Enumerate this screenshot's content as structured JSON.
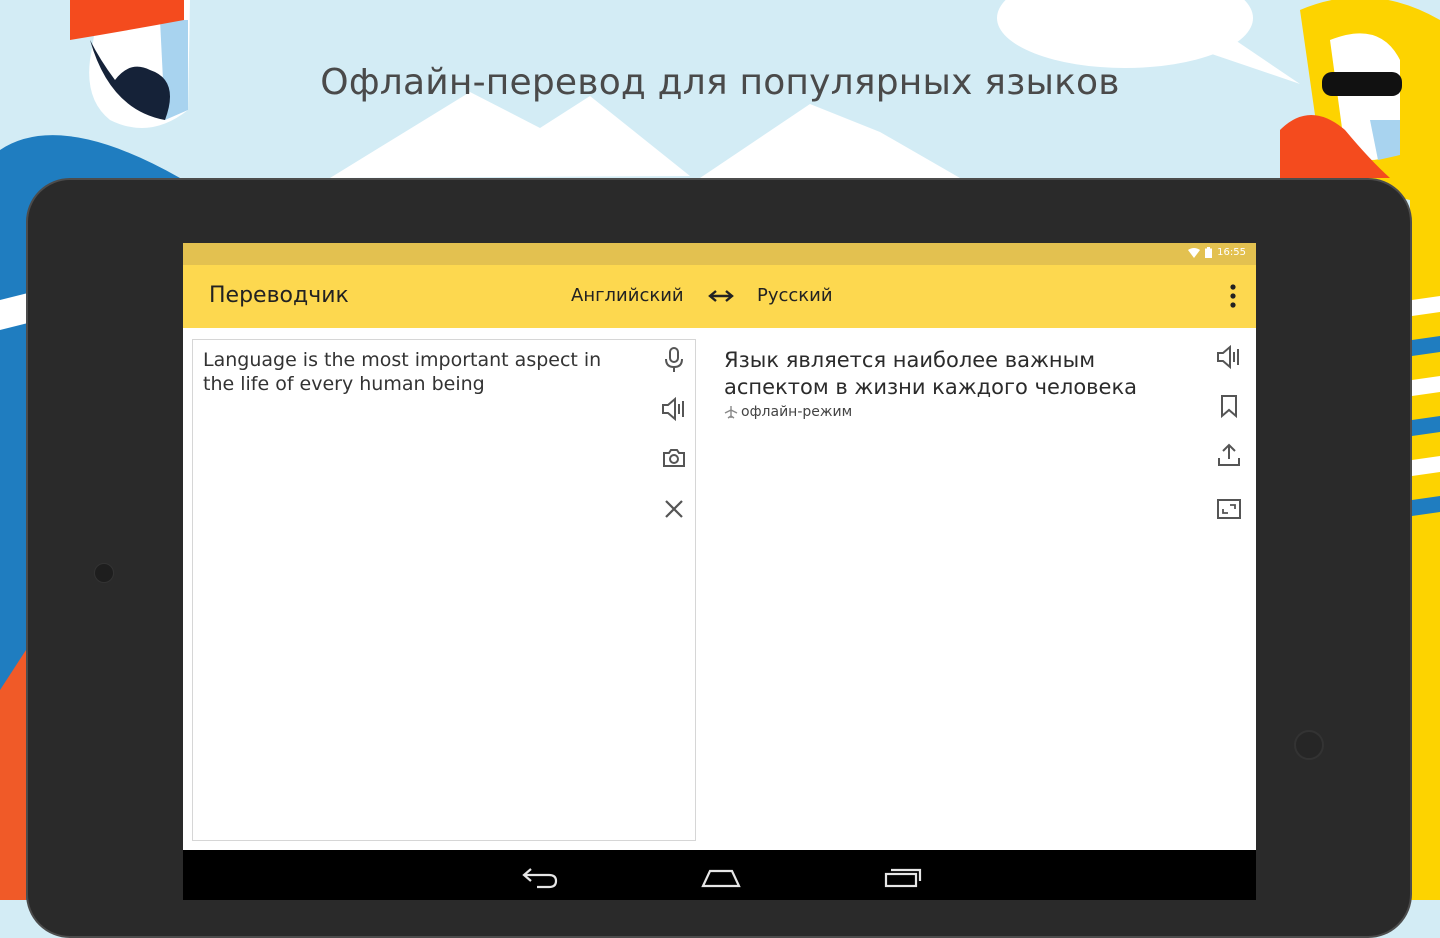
{
  "banner": {
    "headline": "Офлайн-перевод для популярных языков"
  },
  "status_bar": {
    "time": "16:55"
  },
  "app_bar": {
    "title": "Переводчик",
    "source_language": "Английский",
    "target_language": "Русский"
  },
  "input": {
    "text": "Language is the most important aspect in the life of every human being"
  },
  "output": {
    "text": "Язык является наиболее важным аспектом в жизни каждого человека",
    "mode_label": "офлайн-режим"
  },
  "colors": {
    "app_bar": "#fdd84f",
    "status_bar": "#e3c150",
    "background": "#d3ecf5",
    "tablet_bezel": "#2a2a2a",
    "icon": "#555555"
  },
  "icons": {
    "input_actions": [
      "microphone-icon",
      "speaker-icon",
      "camera-icon",
      "close-icon"
    ],
    "output_actions": [
      "speaker-icon",
      "bookmark-icon",
      "share-icon",
      "fullscreen-icon"
    ],
    "nav": [
      "back-icon",
      "home-icon",
      "recents-icon"
    ]
  }
}
